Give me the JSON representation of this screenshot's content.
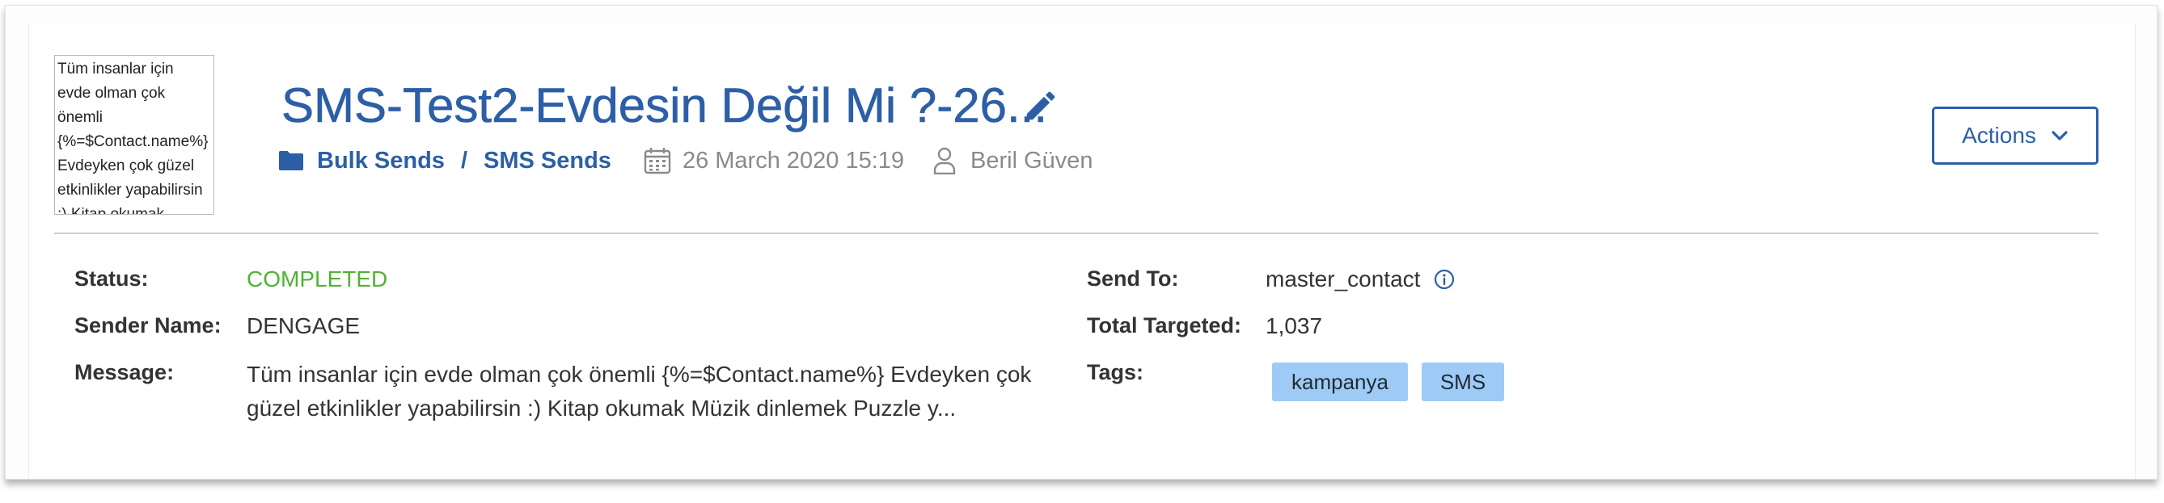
{
  "thumbnail": {
    "text": "Tüm insanlar için evde olman çok önemli {%=$Contact.name%} Evdeyken çok güzel etkinlikler yapabilirsin :) Kitap okumak"
  },
  "header": {
    "title": "SMS-Test2-Evdesin Değil Mi ?-26...",
    "breadcrumb": [
      "Bulk Sends",
      "SMS Sends"
    ],
    "separator": "/",
    "date": "26 March 2020 15:19",
    "user": "Beril Güven",
    "actions_label": "Actions"
  },
  "details": {
    "status_label": "Status:",
    "status_value": "COMPLETED",
    "sender_label": "Sender Name:",
    "sender_value": "DENGAGE",
    "message_label": "Message:",
    "message_value": "Tüm insanlar için evde olman çok önemli {%=$Contact.name%} Evdeyken çok güzel etkinlikler yapabilirsin :) Kitap okumak Müzik dinlemek Puzzle y...",
    "send_to_label": "Send To:",
    "send_to_value": "master_contact",
    "total_label": "Total Targeted:",
    "total_value": "1,037",
    "tags_label": "Tags:",
    "tags": [
      "kampanya",
      "SMS"
    ]
  },
  "icons": {
    "edit": "pencil-icon",
    "folder": "folder-icon",
    "calendar": "calendar-icon",
    "user": "user-icon",
    "info": "info-icon",
    "chevron": "chevron-down-icon"
  },
  "colors": {
    "accent": "#2c5fa6",
    "status_completed": "#4fb234",
    "tag_bg": "#9ecbf5",
    "muted": "#8a8a8a"
  }
}
